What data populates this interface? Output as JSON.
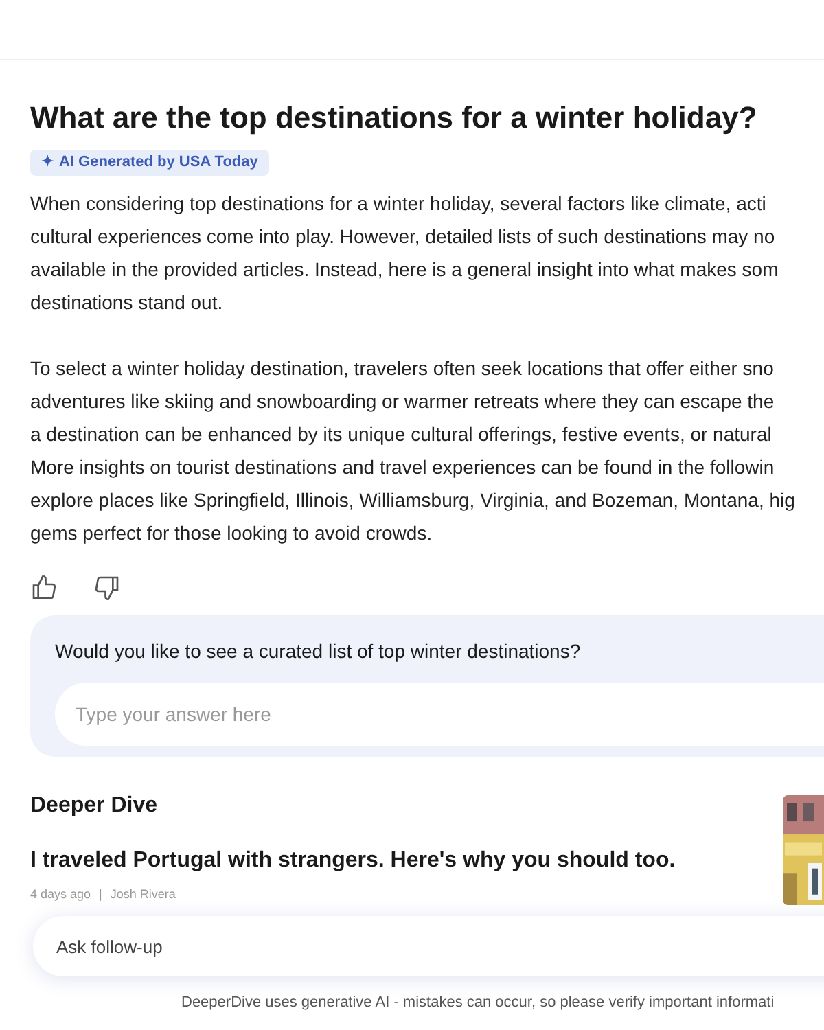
{
  "question": "What are the top destinations for a winter holiday?",
  "badge": {
    "icon": "✦",
    "label": "AI Generated by USA Today"
  },
  "answer": [
    [
      "When considering top destinations for a winter holiday, several factors like climate, acti",
      "cultural experiences come into play. However, detailed lists of such destinations may no",
      "available in the provided articles. Instead, here is a general insight into what makes som",
      "destinations stand out."
    ],
    [
      "To select a winter holiday destination, travelers often seek locations that offer either sno",
      "adventures like skiing and snowboarding or warmer retreats where they can escape the",
      "a destination can be enhanced by its unique cultural offerings, festive events, or natural",
      "More insights on tourist destinations and travel experiences can be found in the followin",
      "explore places like Springfield, Illinois, Williamsburg, Virginia, and Bozeman, Montana, hig",
      "gems perfect for those looking to avoid crowds."
    ]
  ],
  "prompt": {
    "question": "Would you like to see a curated list of top winter destinations?",
    "placeholder": "Type your answer here"
  },
  "deeper_dive": {
    "heading": "Deeper Dive",
    "article": {
      "title": "I traveled Portugal with strangers. Here's why you should too.",
      "age": "4 days ago",
      "separator": "|",
      "author": "Josh Rivera"
    }
  },
  "follow_up": {
    "placeholder": "Ask follow-up"
  },
  "disclaimer": "DeeperDive uses generative AI - mistakes can occur, so please verify important informati"
}
